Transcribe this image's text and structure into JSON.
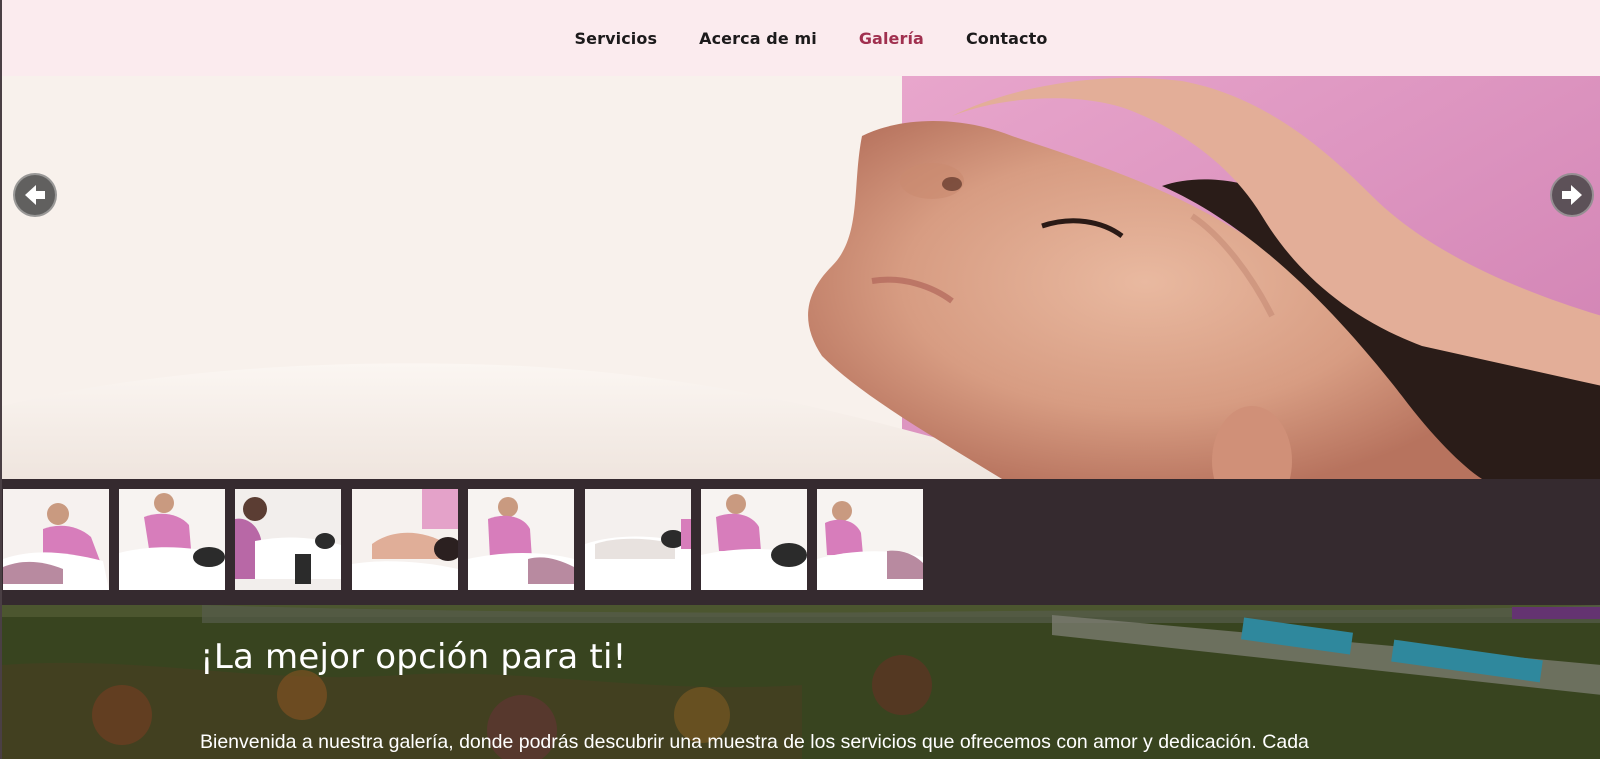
{
  "nav": {
    "items": [
      {
        "label": "Servicios",
        "active": false
      },
      {
        "label": "Acerca de mi",
        "active": false
      },
      {
        "label": "Galería",
        "active": true
      },
      {
        "label": "Contacto",
        "active": false
      }
    ]
  },
  "slider": {
    "prev_icon": "arrow-left-icon",
    "next_icon": "arrow-right-icon",
    "thumbnail_count": 8
  },
  "banner": {
    "title": "¡La mejor opción para ti!",
    "text": "Bienvenida a nuestra galería, donde podrás descubrir una muestra de los servicios que ofrecemos con amor y dedicación. Cada"
  },
  "colors": {
    "nav_bg": "#fbebee",
    "nav_active": "#a0304f",
    "thumb_strip_bg": "#352a2f"
  }
}
